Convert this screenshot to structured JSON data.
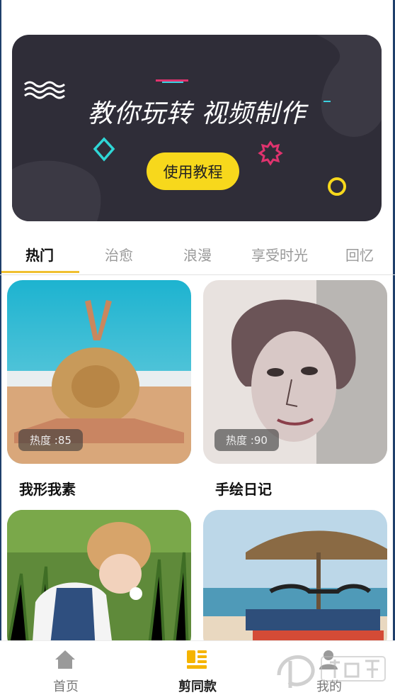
{
  "banner": {
    "title": "教你玩转 视频制作",
    "button_label": "使用教程"
  },
  "tabs": [
    {
      "label": "热门",
      "active": true
    },
    {
      "label": "治愈",
      "active": false
    },
    {
      "label": "浪漫",
      "active": false
    },
    {
      "label": "享受时光",
      "active": false
    },
    {
      "label": "回忆",
      "active": false
    }
  ],
  "cards": [
    {
      "title": "我形我素",
      "heat_label": "热度 :85"
    },
    {
      "title": "手绘日记",
      "heat_label": "热度 :90"
    },
    {
      "title": "",
      "heat_label": ""
    },
    {
      "title": "",
      "heat_label": ""
    }
  ],
  "bottom_nav": [
    {
      "label": "首页",
      "icon": "home-icon",
      "active": false
    },
    {
      "label": "剪同款",
      "icon": "template-icon",
      "active": true
    },
    {
      "label": "我的",
      "icon": "user-icon",
      "active": false
    }
  ],
  "colors": {
    "accent_yellow": "#f7d81c",
    "banner_bg": "#2f2d38",
    "tab_indicator": "#f0c030"
  }
}
